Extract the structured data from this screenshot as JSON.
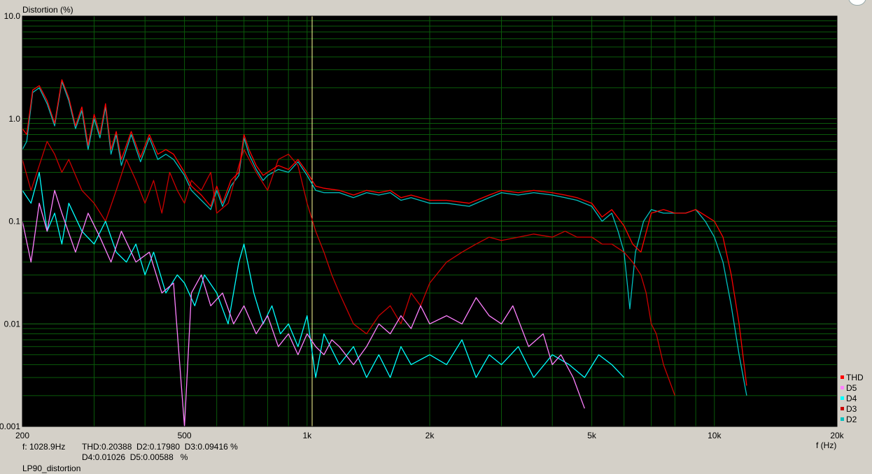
{
  "chart_data": {
    "type": "line",
    "x_scale": "log",
    "y_scale": "log",
    "xlim": [
      200,
      20000
    ],
    "ylim": [
      0.001,
      10
    ],
    "ylabel": "Distortion (%)",
    "xlabel": "f (Hz)",
    "x_ticks": [
      {
        "value": 200,
        "label": "200"
      },
      {
        "value": 500,
        "label": "500"
      },
      {
        "value": 1000,
        "label": "1k"
      },
      {
        "value": 2000,
        "label": "2k"
      },
      {
        "value": 5000,
        "label": "5k"
      },
      {
        "value": 10000,
        "label": "10k"
      },
      {
        "value": 20000,
        "label": "20k"
      }
    ],
    "y_ticks": [
      {
        "value": 10,
        "label": "10.0"
      },
      {
        "value": 1,
        "label": "1.0"
      },
      {
        "value": 0.1,
        "label": "0.1"
      },
      {
        "value": 0.01,
        "label": "0.01"
      },
      {
        "value": 0.001,
        "label": "0.001"
      }
    ],
    "grid": true,
    "legend_position": "bottom-right",
    "cursor_x": 1028.9,
    "series": [
      {
        "name": "THD",
        "color": "#ff0000",
        "x": [
          200,
          205,
          212,
          220,
          230,
          240,
          250,
          260,
          270,
          280,
          290,
          300,
          310,
          320,
          330,
          340,
          350,
          370,
          390,
          410,
          430,
          450,
          470,
          500,
          520,
          550,
          580,
          600,
          620,
          650,
          680,
          700,
          720,
          750,
          780,
          800,
          850,
          900,
          950,
          1000,
          1050,
          1100,
          1200,
          1300,
          1400,
          1500,
          1600,
          1700,
          1800,
          2000,
          2200,
          2500,
          2800,
          3000,
          3300,
          3600,
          4000,
          4300,
          4600,
          5000,
          5300,
          5600,
          6000,
          6300,
          6600,
          7000,
          7500,
          8000,
          8500,
          9000,
          10000,
          10500,
          11000,
          11500,
          12000
        ],
        "y": [
          0.8,
          0.7,
          1.9,
          2.1,
          1.5,
          0.9,
          2.4,
          1.6,
          0.85,
          1.3,
          0.55,
          1.1,
          0.7,
          1.4,
          0.5,
          0.75,
          0.4,
          0.75,
          0.42,
          0.7,
          0.45,
          0.5,
          0.45,
          0.3,
          0.22,
          0.18,
          0.14,
          0.22,
          0.15,
          0.25,
          0.3,
          0.7,
          0.5,
          0.35,
          0.28,
          0.3,
          0.35,
          0.32,
          0.4,
          0.3,
          0.22,
          0.21,
          0.2,
          0.18,
          0.2,
          0.19,
          0.2,
          0.17,
          0.18,
          0.16,
          0.16,
          0.15,
          0.18,
          0.2,
          0.19,
          0.2,
          0.19,
          0.18,
          0.17,
          0.15,
          0.11,
          0.13,
          0.09,
          0.06,
          0.05,
          0.12,
          0.13,
          0.12,
          0.12,
          0.13,
          0.1,
          0.07,
          0.03,
          0.01,
          0.0025
        ]
      },
      {
        "name": "D5",
        "color": "#ff80ff",
        "x": [
          200,
          210,
          220,
          230,
          240,
          250,
          270,
          290,
          310,
          330,
          350,
          380,
          410,
          440,
          470,
          500,
          520,
          550,
          580,
          620,
          660,
          700,
          750,
          800,
          850,
          900,
          950,
          1000,
          1050,
          1100,
          1150,
          1200,
          1300,
          1400,
          1500,
          1600,
          1700,
          1800,
          1900,
          2000,
          2200,
          2400,
          2600,
          2800,
          3000,
          3200,
          3500,
          3800,
          4000,
          4200,
          4500,
          4800
        ],
        "y": [
          0.1,
          0.04,
          0.15,
          0.08,
          0.2,
          0.12,
          0.05,
          0.12,
          0.07,
          0.04,
          0.08,
          0.04,
          0.05,
          0.02,
          0.025,
          0.001,
          0.02,
          0.03,
          0.015,
          0.02,
          0.01,
          0.015,
          0.008,
          0.012,
          0.006,
          0.008,
          0.005,
          0.008,
          0.006,
          0.005,
          0.007,
          0.006,
          0.004,
          0.006,
          0.01,
          0.008,
          0.012,
          0.009,
          0.015,
          0.01,
          0.012,
          0.01,
          0.018,
          0.012,
          0.01,
          0.015,
          0.006,
          0.008,
          0.004,
          0.005,
          0.003,
          0.0015
        ]
      },
      {
        "name": "D4",
        "color": "#00ffff",
        "x": [
          200,
          210,
          220,
          230,
          240,
          250,
          260,
          280,
          300,
          320,
          340,
          360,
          380,
          400,
          420,
          450,
          480,
          500,
          530,
          560,
          600,
          640,
          680,
          700,
          740,
          780,
          820,
          860,
          900,
          950,
          1000,
          1050,
          1100,
          1200,
          1300,
          1400,
          1500,
          1600,
          1700,
          1800,
          2000,
          2200,
          2400,
          2600,
          2800,
          3000,
          3300,
          3600,
          4000,
          4400,
          4800,
          5200,
          5600,
          6000
        ],
        "y": [
          0.2,
          0.15,
          0.3,
          0.08,
          0.12,
          0.06,
          0.15,
          0.08,
          0.06,
          0.1,
          0.05,
          0.04,
          0.06,
          0.03,
          0.05,
          0.02,
          0.03,
          0.025,
          0.015,
          0.03,
          0.02,
          0.01,
          0.04,
          0.06,
          0.02,
          0.01,
          0.015,
          0.008,
          0.01,
          0.006,
          0.012,
          0.003,
          0.008,
          0.004,
          0.006,
          0.003,
          0.005,
          0.003,
          0.006,
          0.004,
          0.005,
          0.004,
          0.007,
          0.003,
          0.005,
          0.004,
          0.006,
          0.003,
          0.005,
          0.004,
          0.003,
          0.005,
          0.004,
          0.003
        ]
      },
      {
        "name": "D3",
        "color": "#cc0000",
        "x": [
          200,
          210,
          220,
          230,
          240,
          250,
          260,
          280,
          300,
          320,
          340,
          360,
          380,
          400,
          420,
          440,
          460,
          480,
          500,
          520,
          550,
          580,
          600,
          640,
          680,
          700,
          750,
          800,
          850,
          900,
          950,
          1000,
          1050,
          1100,
          1150,
          1200,
          1300,
          1400,
          1500,
          1600,
          1700,
          1800,
          1900,
          2000,
          2200,
          2400,
          2600,
          2800,
          3000,
          3300,
          3600,
          4000,
          4300,
          4600,
          5000,
          5300,
          5600,
          6000,
          6300,
          6600,
          6800,
          7000,
          7200,
          7500,
          8000
        ],
        "y": [
          0.4,
          0.2,
          0.35,
          0.6,
          0.45,
          0.3,
          0.4,
          0.2,
          0.15,
          0.1,
          0.2,
          0.4,
          0.25,
          0.15,
          0.25,
          0.12,
          0.3,
          0.2,
          0.15,
          0.25,
          0.2,
          0.3,
          0.12,
          0.15,
          0.35,
          0.5,
          0.3,
          0.2,
          0.4,
          0.45,
          0.35,
          0.15,
          0.08,
          0.05,
          0.03,
          0.02,
          0.01,
          0.008,
          0.012,
          0.015,
          0.01,
          0.02,
          0.015,
          0.025,
          0.04,
          0.05,
          0.06,
          0.07,
          0.065,
          0.07,
          0.075,
          0.07,
          0.08,
          0.07,
          0.07,
          0.06,
          0.06,
          0.05,
          0.04,
          0.03,
          0.02,
          0.01,
          0.008,
          0.004,
          0.002
        ]
      },
      {
        "name": "D2",
        "color": "#00c0c0",
        "x": [
          200,
          205,
          212,
          220,
          230,
          240,
          250,
          260,
          270,
          280,
          290,
          300,
          310,
          320,
          330,
          340,
          350,
          370,
          390,
          410,
          430,
          450,
          470,
          500,
          520,
          550,
          580,
          600,
          620,
          650,
          680,
          700,
          720,
          750,
          780,
          800,
          850,
          900,
          950,
          1000,
          1050,
          1100,
          1200,
          1300,
          1400,
          1500,
          1600,
          1700,
          1800,
          2000,
          2200,
          2500,
          2800,
          3000,
          3300,
          3600,
          4000,
          4300,
          4600,
          5000,
          5300,
          5600,
          5800,
          6000,
          6200,
          6400,
          6700,
          7000,
          7500,
          8000,
          8500,
          9000,
          9500,
          10000,
          10500,
          11000,
          11500,
          12000
        ],
        "y": [
          0.5,
          0.6,
          1.8,
          2.0,
          1.4,
          0.85,
          2.3,
          1.5,
          0.8,
          1.2,
          0.5,
          1.0,
          0.65,
          1.3,
          0.45,
          0.7,
          0.35,
          0.7,
          0.38,
          0.65,
          0.4,
          0.45,
          0.4,
          0.28,
          0.2,
          0.16,
          0.13,
          0.2,
          0.14,
          0.22,
          0.28,
          0.65,
          0.45,
          0.32,
          0.25,
          0.28,
          0.32,
          0.3,
          0.38,
          0.28,
          0.2,
          0.19,
          0.19,
          0.17,
          0.19,
          0.18,
          0.19,
          0.16,
          0.17,
          0.15,
          0.15,
          0.14,
          0.17,
          0.19,
          0.18,
          0.19,
          0.18,
          0.17,
          0.16,
          0.14,
          0.1,
          0.12,
          0.08,
          0.05,
          0.014,
          0.05,
          0.1,
          0.13,
          0.12,
          0.12,
          0.12,
          0.13,
          0.1,
          0.07,
          0.04,
          0.015,
          0.005,
          0.002
        ]
      }
    ]
  },
  "readout": {
    "freq": "f: 1028.9Hz",
    "line1": "THD:0.20388  D2:0.17980  D3:0.09416 %",
    "line2": "D4:0.01026  D5:0.00588   %"
  },
  "footer": {
    "name": "LP90_distortion"
  }
}
